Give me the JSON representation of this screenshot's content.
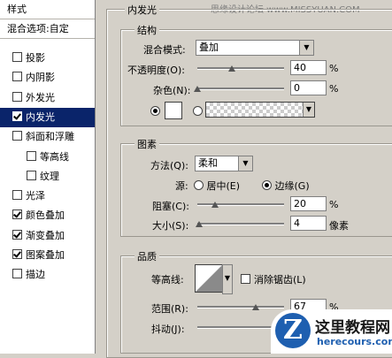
{
  "watermark": "思缘设计论坛 www.MISSYUAN.COM",
  "left_panel": {
    "header": "样式",
    "blend_options": "混合选项:自定",
    "items": [
      {
        "label": "投影",
        "checked": false
      },
      {
        "label": "内阴影",
        "checked": false
      },
      {
        "label": "外发光",
        "checked": false
      },
      {
        "label": "内发光",
        "checked": true
      },
      {
        "label": "斜面和浮雕",
        "checked": false
      },
      {
        "label": "等高线",
        "checked": false
      },
      {
        "label": "纹理",
        "checked": false
      },
      {
        "label": "光泽",
        "checked": false
      },
      {
        "label": "颜色叠加",
        "checked": true
      },
      {
        "label": "渐变叠加",
        "checked": true
      },
      {
        "label": "图案叠加",
        "checked": true
      },
      {
        "label": "描边",
        "checked": false
      }
    ]
  },
  "inner_glow": {
    "title": "内发光",
    "structure": {
      "title": "结构",
      "blend_mode_label": "混合模式:",
      "blend_mode_value": "叠加",
      "opacity_label": "不透明度(O):",
      "opacity_value": "40",
      "opacity_unit": "%",
      "opacity_level": 0.4,
      "noise_label": "杂色(N):",
      "noise_value": "0",
      "noise_unit": "%",
      "noise_level": 0.0
    },
    "elements": {
      "title": "图素",
      "method_label": "方法(Q):",
      "method_value": "柔和",
      "source_label": "源:",
      "source_center": "居中(E)",
      "source_edge": "边缘(G)",
      "choke_label": "阻塞(C):",
      "choke_value": "20",
      "choke_unit": "%",
      "choke_level": 0.2,
      "size_label": "大小(S):",
      "size_value": "4",
      "size_unit": "像素",
      "size_level": 0.02
    },
    "quality": {
      "title": "品质",
      "contour_label": "等高线:",
      "anti_alias_label": "消除锯齿(L)",
      "range_label": "范围(R):",
      "range_value": "67",
      "range_unit": "%",
      "range_level": 0.67,
      "jitter_label": "抖动(J):"
    }
  },
  "logo": {
    "letter": "Z",
    "title": "这里教程网",
    "url": "herecours.com"
  }
}
